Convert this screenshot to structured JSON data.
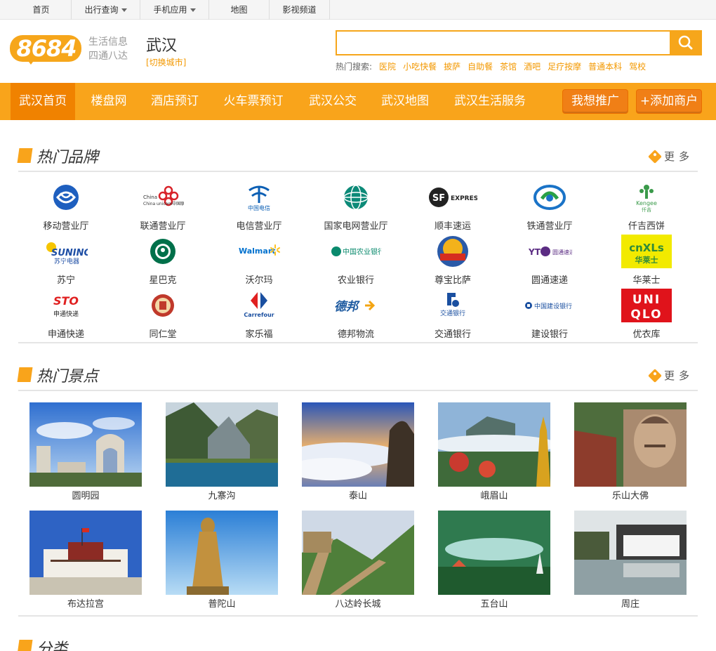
{
  "topnav": {
    "items": [
      {
        "label": "首页",
        "dropdown": false
      },
      {
        "label": "出行查询",
        "dropdown": true
      },
      {
        "label": "手机应用",
        "dropdown": true
      },
      {
        "label": "地图",
        "dropdown": false
      },
      {
        "label": "影视频道",
        "dropdown": false
      }
    ]
  },
  "header": {
    "logo_text": "8684",
    "slogan_line1": "生活信息",
    "slogan_line2": "四通八达",
    "city": "武汉",
    "switch_city": "[切换城市]"
  },
  "search": {
    "placeholder": "",
    "value": "",
    "hot_label": "热门搜索:",
    "hot_keywords": [
      "医院",
      "小吃快餐",
      "披萨",
      "自助餐",
      "茶馆",
      "酒吧",
      "足疗按摩",
      "普通本科",
      "驾校"
    ]
  },
  "mainnav": {
    "items": [
      "武汉首页",
      "楼盘网",
      "酒店预订",
      "火车票预订",
      "武汉公交",
      "武汉地图",
      "武汉生活服务"
    ],
    "promote_button": "我想推广",
    "add_merchant_button": "+添加商户"
  },
  "brands_section": {
    "title": "热门品牌",
    "more": "更多",
    "brands": [
      {
        "name": "移动营业厅",
        "icon": "china-mobile-logo"
      },
      {
        "name": "联通营业厅",
        "icon": "china-unicom-logo"
      },
      {
        "name": "电信营业厅",
        "icon": "china-telecom-logo"
      },
      {
        "name": "国家电网营业厅",
        "icon": "state-grid-logo"
      },
      {
        "name": "顺丰速运",
        "icon": "sf-express-logo"
      },
      {
        "name": "铁通营业厅",
        "icon": "china-tietong-logo"
      },
      {
        "name": "仟吉西饼",
        "icon": "kengee-logo"
      },
      {
        "name": "苏宁",
        "icon": "suning-logo"
      },
      {
        "name": "星巴克",
        "icon": "starbucks-logo"
      },
      {
        "name": "沃尔玛",
        "icon": "walmart-logo"
      },
      {
        "name": "农业银行",
        "icon": "abc-bank-logo"
      },
      {
        "name": "尊宝比萨",
        "icon": "zunbao-pizza-logo"
      },
      {
        "name": "圆通速递",
        "icon": "yto-express-logo"
      },
      {
        "name": "华莱士",
        "icon": "wallace-logo"
      },
      {
        "name": "申通快递",
        "icon": "sto-express-logo"
      },
      {
        "name": "同仁堂",
        "icon": "tongrentang-logo"
      },
      {
        "name": "家乐福",
        "icon": "carrefour-logo"
      },
      {
        "name": "德邦物流",
        "icon": "deppon-logo"
      },
      {
        "name": "交通银行",
        "icon": "bocom-logo"
      },
      {
        "name": "建设银行",
        "icon": "ccb-logo"
      },
      {
        "name": "优衣库",
        "icon": "uniqlo-logo"
      }
    ],
    "logo_text": {
      "unicom": "China unicom中国联通",
      "telecom": "中国电信",
      "sf": "EXPRESS",
      "kengee": "Kengee",
      "kengee_cn": "仟吉",
      "suning": "SUNING",
      "suning_cn": "苏宁电器",
      "walmart": "Walmart",
      "abc": "中国农业银行",
      "yto": "圆通速递",
      "wallace": "华莱士",
      "sto": "STO",
      "sto_cn": "申通快递",
      "carrefour": "Carrefour",
      "deppon": "德邦",
      "bocom": "交通银行",
      "ccb": "中国建设银行",
      "uniqlo_1": "UNI",
      "uniqlo_2": "QLO"
    }
  },
  "spots_section": {
    "title": "热门景点",
    "more": "更多",
    "spots": [
      {
        "name": "圆明园"
      },
      {
        "name": "九寨沟"
      },
      {
        "name": "泰山"
      },
      {
        "name": "峨眉山"
      },
      {
        "name": "乐山大佛"
      },
      {
        "name": "布达拉宫"
      },
      {
        "name": "普陀山"
      },
      {
        "name": "八达岭长城"
      },
      {
        "name": "五台山"
      },
      {
        "name": "周庄"
      }
    ]
  },
  "category_section": {
    "title": "分类"
  },
  "colors": {
    "brand_orange": "#f9a41b",
    "nav_active": "#f08200",
    "link_orange": "#f39800"
  }
}
